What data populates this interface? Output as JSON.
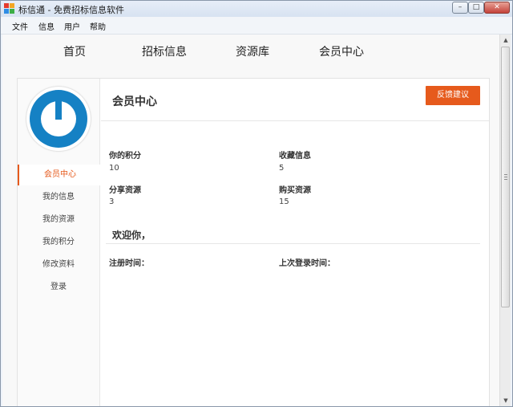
{
  "window": {
    "title": "标信通 - 免费招标信息软件",
    "min_label": "–",
    "max_label": "□",
    "close_label": "✕"
  },
  "menu": [
    "文件",
    "信息",
    "用户",
    "帮助"
  ],
  "nav": [
    "首页",
    "招标信息",
    "资源库",
    "会员中心"
  ],
  "sidebar": {
    "items": [
      "会员中心",
      "我的信息",
      "我的资源",
      "我的积分",
      "修改资料",
      "登录"
    ]
  },
  "main": {
    "title": "会员中心",
    "feedback_button": "反馈建议",
    "stats": [
      {
        "label": "你的积分",
        "value": "10"
      },
      {
        "label": "收藏信息",
        "value": "5"
      },
      {
        "label": "分享资源",
        "value": "3"
      },
      {
        "label": "购买资源",
        "value": "15"
      }
    ],
    "welcome": "欢迎你，",
    "register_time_label": "注册时间：",
    "last_login_label": "上次登录时间："
  },
  "colors": {
    "accent": "#e65a1c",
    "logo_blue": "#1581c4"
  },
  "icons": {
    "app": "app-icon",
    "logo": "power-logo-icon"
  }
}
